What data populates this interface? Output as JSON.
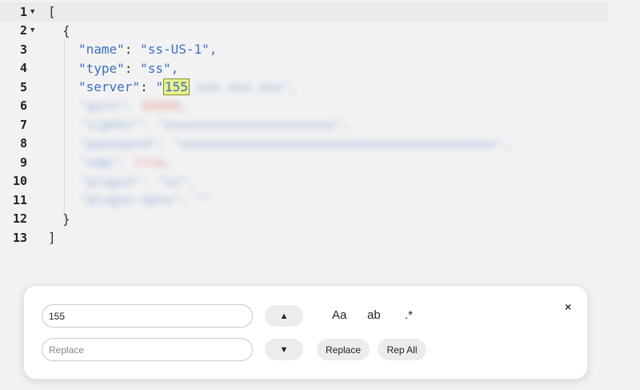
{
  "editor": {
    "lines": [
      {
        "num": "1",
        "fold": true
      },
      {
        "num": "2",
        "fold": true
      },
      {
        "num": "3",
        "fold": false
      },
      {
        "num": "4",
        "fold": false
      },
      {
        "num": "5",
        "fold": false
      },
      {
        "num": "6",
        "fold": false
      },
      {
        "num": "7",
        "fold": false
      },
      {
        "num": "8",
        "fold": false
      },
      {
        "num": "9",
        "fold": false
      },
      {
        "num": "10",
        "fold": false
      },
      {
        "num": "11",
        "fold": false
      },
      {
        "num": "12",
        "fold": true
      },
      {
        "num": "13",
        "fold": false
      }
    ],
    "fold_glyph": "▼",
    "open_bracket": "[",
    "open_brace": "{",
    "close_brace": "}",
    "close_bracket": "]",
    "name_key": "\"name\"",
    "name_value": "\"ss-US-1\",",
    "type_key": "\"type\"",
    "type_value": "\"ss\",",
    "server_key": "\"server\"",
    "server_value_prefix": "\"",
    "server_match": "155",
    "colon": ": "
  },
  "find_panel": {
    "find_value": "155",
    "replace_placeholder": "Replace",
    "prev_glyph": "▲",
    "next_glyph": "▼",
    "match_case_label": "Aa",
    "whole_word_label": "ab",
    "regex_label": ".*",
    "replace_label": "Replace",
    "replace_all_label": "Rep All",
    "close_glyph": "×"
  }
}
